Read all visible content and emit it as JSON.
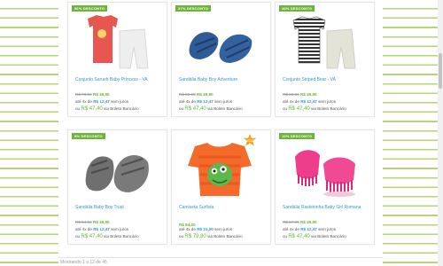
{
  "products": [
    {
      "badge": "56% DESCONTO",
      "title": "Conjunto Sarueh Baby Princess - VA",
      "old_price": "R$ 79,90",
      "price": "R$ 49,90",
      "inst_prefix": "até 4x de",
      "inst_value": "R$ 12,47",
      "inst_suffix": "sem juros",
      "boleto_prefix": "ou",
      "boleto_value": "R$ 47,40",
      "boleto_suffix": "via Boleto Bancário",
      "image": "baby-bodysuit-set-icon"
    },
    {
      "badge": "37% DESCONTO",
      "title": "Sandália Baby Boy Adventure",
      "old_price": "R$ 59,90",
      "price": "R$ 49,90",
      "inst_prefix": "até 4x de",
      "inst_value": "R$ 12,47",
      "inst_suffix": "sem juros",
      "boleto_prefix": "ou",
      "boleto_value": "R$ 47,40",
      "boleto_suffix": "via Boleto Bancário",
      "image": "baby-sandals-icon"
    },
    {
      "badge": "40% DESCONTO",
      "title": "Conjunto Striped Bear - VA",
      "old_price": "R$ 89,90",
      "price": "R$ 49,90",
      "inst_prefix": "até 4x de",
      "inst_value": "R$ 12,47",
      "inst_suffix": "sem juros",
      "boleto_prefix": "ou",
      "boleto_value": "R$ 47,40",
      "boleto_suffix": "via Boleto Bancário",
      "image": "striped-bodysuit-set-icon"
    },
    {
      "badge": "9% DESCONTO",
      "title": "Sandália Baby Boy Trust",
      "old_price": "R$ 54,90",
      "price": "R$ 49,90",
      "inst_prefix": "até 4x de",
      "inst_value": "R$ 12,47",
      "inst_suffix": "sem juros",
      "boleto_prefix": "ou",
      "boleto_value": "R$ 47,40",
      "boleto_suffix": "via Boleto Bancário",
      "image": "baby-boots-icon"
    },
    {
      "badge": "",
      "title": "Camiseta Surfista",
      "old_price": "",
      "price": "R$ 84,00",
      "inst_prefix": "até 4x de",
      "inst_value": "R$ 21,00",
      "inst_suffix": "sem juros",
      "boleto_prefix": "ou",
      "boleto_value": "R$ 79,80",
      "boleto_suffix": "via Boleto Bancário",
      "image": "monster-tshirt-icon"
    },
    {
      "badge": "10% DESCONTO",
      "title": "Sandália Rasteirinha Baby Girl Romana",
      "old_price": "R$ 57,00",
      "price": "R$ 49,90",
      "inst_prefix": "até 4x de",
      "inst_value": "R$ 12,47",
      "inst_suffix": "sem juros",
      "boleto_prefix": "ou",
      "boleto_value": "R$ 47,40",
      "boleto_suffix": "via Boleto Bancário",
      "image": "pink-fringe-sandals-icon"
    }
  ],
  "new_badge": "NOVO",
  "footer": {
    "text": "Mostrando 1 a 12 de 45"
  },
  "colors": {
    "accent_green": "#6fb33a",
    "link_blue": "#2a9bd1",
    "stripe_green": "#a9cf5d"
  }
}
